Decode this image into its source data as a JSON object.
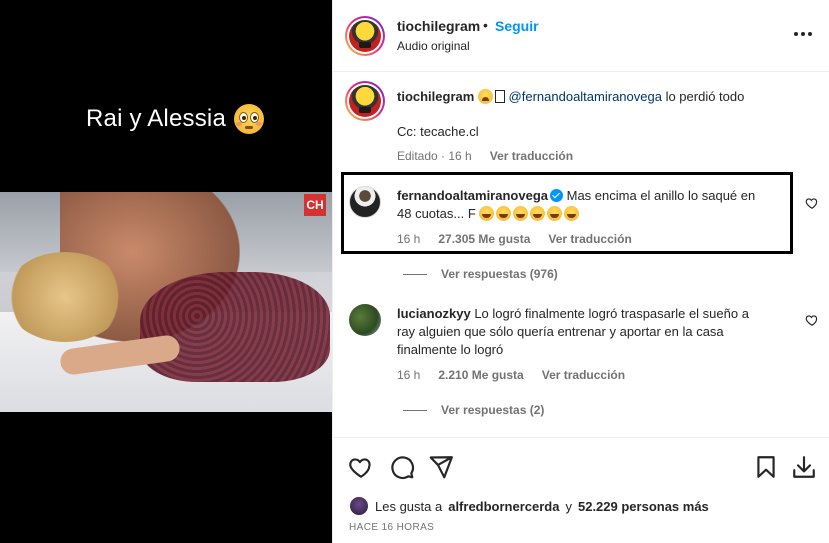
{
  "media": {
    "caption_text": "Rai y Alessia",
    "caption_emoji": "flushed-face-emoji",
    "corner_tag": "CH"
  },
  "header": {
    "username": "tiochilegram",
    "dot": "•",
    "follow_label": "Seguir",
    "subtitle": "Audio original"
  },
  "caption": {
    "username": "tiochilegram",
    "mention": "@fernandoaltamiranovega",
    "text_after": "lo perdió todo",
    "line2": "Cc: tecache.cl",
    "edited": "Editado",
    "time": "16 h",
    "translate": "Ver traducción"
  },
  "comments": [
    {
      "username": "fernandoaltamiranovega",
      "verified": true,
      "text_line1": "Mas encima el anillo lo saqué en",
      "text_line2": "48 cuotas... F",
      "time": "16 h",
      "likes": "27.305 Me gusta",
      "translate": "Ver traducción",
      "replies": "Ver respuestas (976)"
    },
    {
      "username": "lucianozkyy",
      "text_line1": "Lo logró finalmente logró traspasarle el sueño a",
      "text_line2": "ray alguien que sólo quería entrenar y aportar en la casa",
      "text_line3": "finalmente lo logró",
      "time": "16 h",
      "likes": "2.210 Me gusta",
      "translate": "Ver traducción",
      "replies": "Ver respuestas (2)"
    }
  ],
  "actions": {
    "likes_prefix": "Les gusta a",
    "likes_user": "alfredbornercerda",
    "likes_mid": "y",
    "likes_count": "52.229 personas más",
    "timestamp": "HACE 16 HORAS"
  },
  "colors": {
    "accent": "#0095f6",
    "text": "#262626",
    "muted": "#737373",
    "mention": "#00376b"
  }
}
